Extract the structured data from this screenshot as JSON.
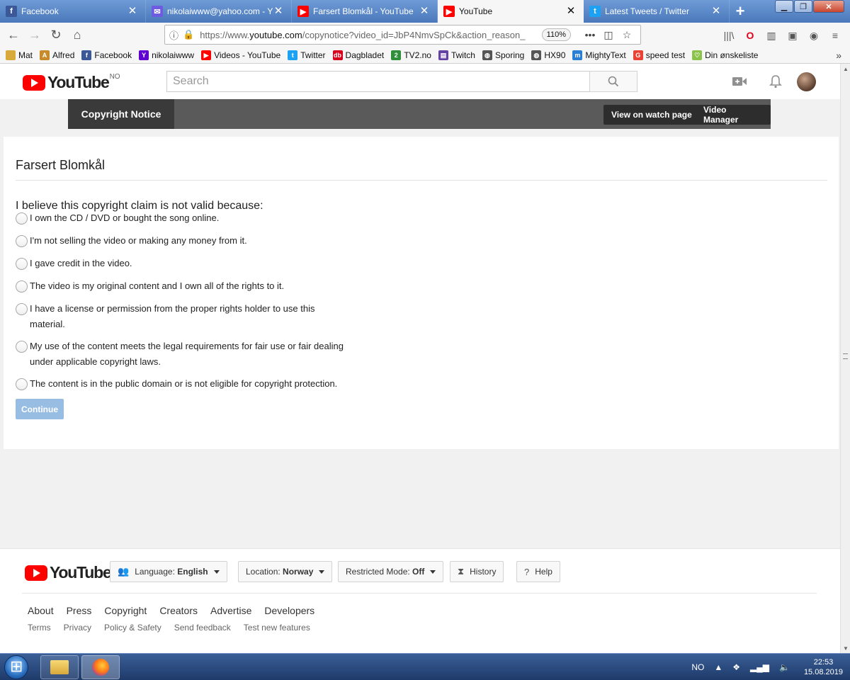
{
  "browser": {
    "tabs": [
      {
        "title": "Facebook",
        "icon": "facebook-icon",
        "color": "#3b5998"
      },
      {
        "title": "nikolaiwww@yahoo.com - Yahoo",
        "icon": "mail-icon",
        "color": "#6d5be0"
      },
      {
        "title": "Farsert Blomkål - YouTube",
        "icon": "youtube-icon",
        "color": "#ff0000"
      },
      {
        "title": "YouTube",
        "icon": "youtube-icon",
        "color": "#ff0000"
      },
      {
        "title": "Latest Tweets / Twitter",
        "icon": "twitter-icon",
        "color": "#1da1f2"
      }
    ],
    "active_tab": 3,
    "url_prefix": "https://www.",
    "url_host": "youtube.com",
    "url_path": "/copynotice?video_id=JbP4NmvSpCk&action_reason_",
    "zoom": "110%",
    "bookmarks": [
      {
        "label": "Mat",
        "icon": "folder-icon",
        "color": "#d9a93b"
      },
      {
        "label": "Alfred",
        "icon": "alfred-icon",
        "color": "#c88b2a"
      },
      {
        "label": "Facebook",
        "icon": "facebook-icon",
        "color": "#3b5998"
      },
      {
        "label": "nikolaiwww",
        "icon": "yahoo-icon",
        "color": "#6001d2"
      },
      {
        "label": "Videos - YouTube",
        "icon": "youtube-icon",
        "color": "#ff0000"
      },
      {
        "label": "Twitter",
        "icon": "twitter-icon",
        "color": "#1da1f2"
      },
      {
        "label": "Dagbladet",
        "icon": "dagbladet-icon",
        "color": "#d6001c"
      },
      {
        "label": "TV2.no",
        "icon": "tv2-icon",
        "color": "#2f8f3a"
      },
      {
        "label": "Twitch",
        "icon": "twitch-icon",
        "color": "#6441a5"
      },
      {
        "label": "Sporing",
        "icon": "globe-icon",
        "color": "#555555"
      },
      {
        "label": "HX90",
        "icon": "globe-icon",
        "color": "#555555"
      },
      {
        "label": "MightyText",
        "icon": "mightytext-icon",
        "color": "#2a7fd4"
      },
      {
        "label": "speed test",
        "icon": "google-icon",
        "color": "#ea4335"
      },
      {
        "label": "Din ønskeliste",
        "icon": "wishlist-icon",
        "color": "#8bc34a"
      }
    ]
  },
  "youtube": {
    "logo_word": "YouTube",
    "country": "NO",
    "search_placeholder": "Search"
  },
  "subnav": {
    "active_label": "Copyright Notice",
    "watch_page": "View on watch page",
    "video_manager": "Video Manager"
  },
  "form": {
    "video_title": "Farsert Blomkål",
    "question": "I believe this copyright claim is not valid because:",
    "options": [
      "I own the CD / DVD or bought the song online.",
      "I'm not selling the video or making any money from it.",
      "I gave credit in the video.",
      "The video is my original content and I own all of the rights to it.",
      "I have a license or permission from the proper rights holder to use this material.",
      "My use of the content meets the legal requirements for fair use or fair dealing under applicable copyright laws.",
      "The content is in the public domain or is not eligible for copyright protection."
    ],
    "continue_label": "Continue"
  },
  "footer": {
    "language_label": "Language:",
    "language_value": "English",
    "location_label": "Location:",
    "location_value": "Norway",
    "restricted_label": "Restricted Mode:",
    "restricted_value": "Off",
    "history": "History",
    "help": "Help",
    "primary_links": [
      "About",
      "Press",
      "Copyright",
      "Creators",
      "Advertise",
      "Developers"
    ],
    "secondary_links": [
      "Terms",
      "Privacy",
      "Policy & Safety",
      "Send feedback",
      "Test new features"
    ]
  },
  "taskbar": {
    "lang": "NO",
    "time": "22:53",
    "date": "15.08.2019"
  }
}
